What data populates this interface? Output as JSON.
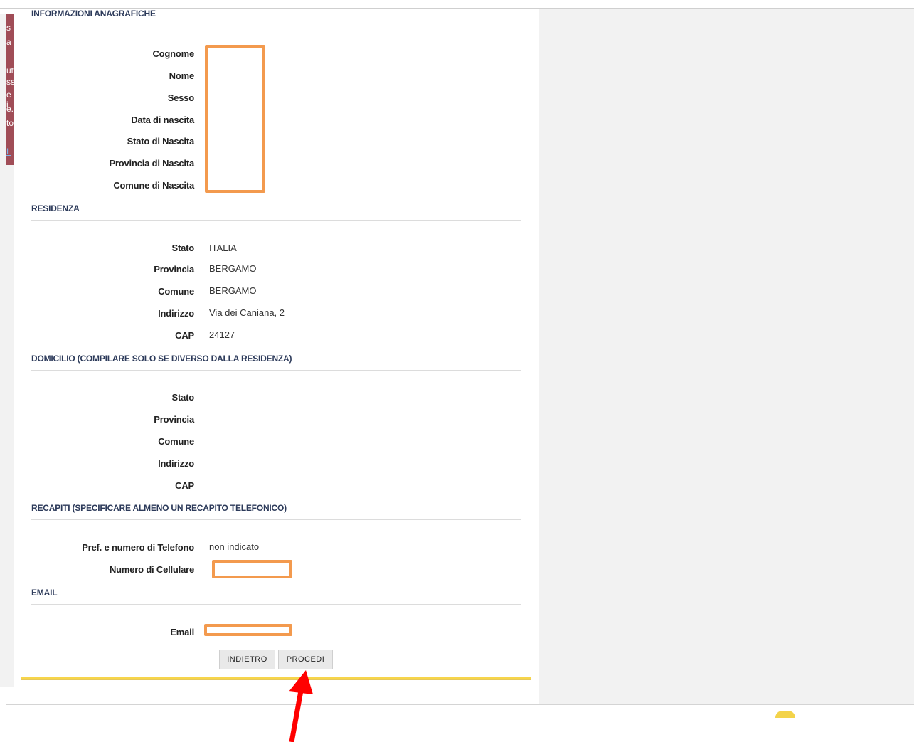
{
  "left_peek": {
    "letters": [
      "s",
      "a",
      "ut",
      "ss",
      "e i",
      "e.",
      "to"
    ],
    "link_text": "L"
  },
  "sections": {
    "anagrafiche": "INFORMAZIONI ANAGRAFICHE",
    "residenza": "RESIDENZA",
    "domicilio": "DOMICILIO (COMPILARE SOLO SE DIVERSO DALLA RESIDENZA)",
    "recapiti": "RECAPITI (SPECIFICARE ALMENO UN RECAPITO TELEFONICO)",
    "email": "EMAIL"
  },
  "anagrafiche": {
    "cognome_label": "Cognome",
    "nome_label": "Nome",
    "sesso_label": "Sesso",
    "data_nascita_label": "Data di nascita",
    "stato_nascita_label": "Stato di Nascita",
    "provincia_nascita_label": "Provincia di Nascita",
    "comune_nascita_label": "Comune di Nascita"
  },
  "residenza": {
    "stato_label": "Stato",
    "stato_value": "ITALIA",
    "provincia_label": "Provincia",
    "provincia_value": "BERGAMO",
    "comune_label": "Comune",
    "comune_value": "BERGAMO",
    "indirizzo_label": "Indirizzo",
    "indirizzo_value": "Via dei Caniana, 2",
    "cap_label": "CAP",
    "cap_value": "24127"
  },
  "domicilio": {
    "stato_label": "Stato",
    "provincia_label": "Provincia",
    "comune_label": "Comune",
    "indirizzo_label": "Indirizzo",
    "cap_label": "CAP"
  },
  "recapiti": {
    "telefono_label": "Pref. e numero di Telefono",
    "telefono_value": "non indicato",
    "cellulare_label": "Numero di Cellulare"
  },
  "email": {
    "email_label": "Email"
  },
  "buttons": {
    "back": "INDIETRO",
    "proceed": "PROCEDI"
  },
  "colors": {
    "section_title": "#2c3a5a",
    "redaction": "#f39a4e",
    "arrow": "#ff0000",
    "accent_rule": "#f7d54a",
    "left_peek": "#a04d57"
  }
}
